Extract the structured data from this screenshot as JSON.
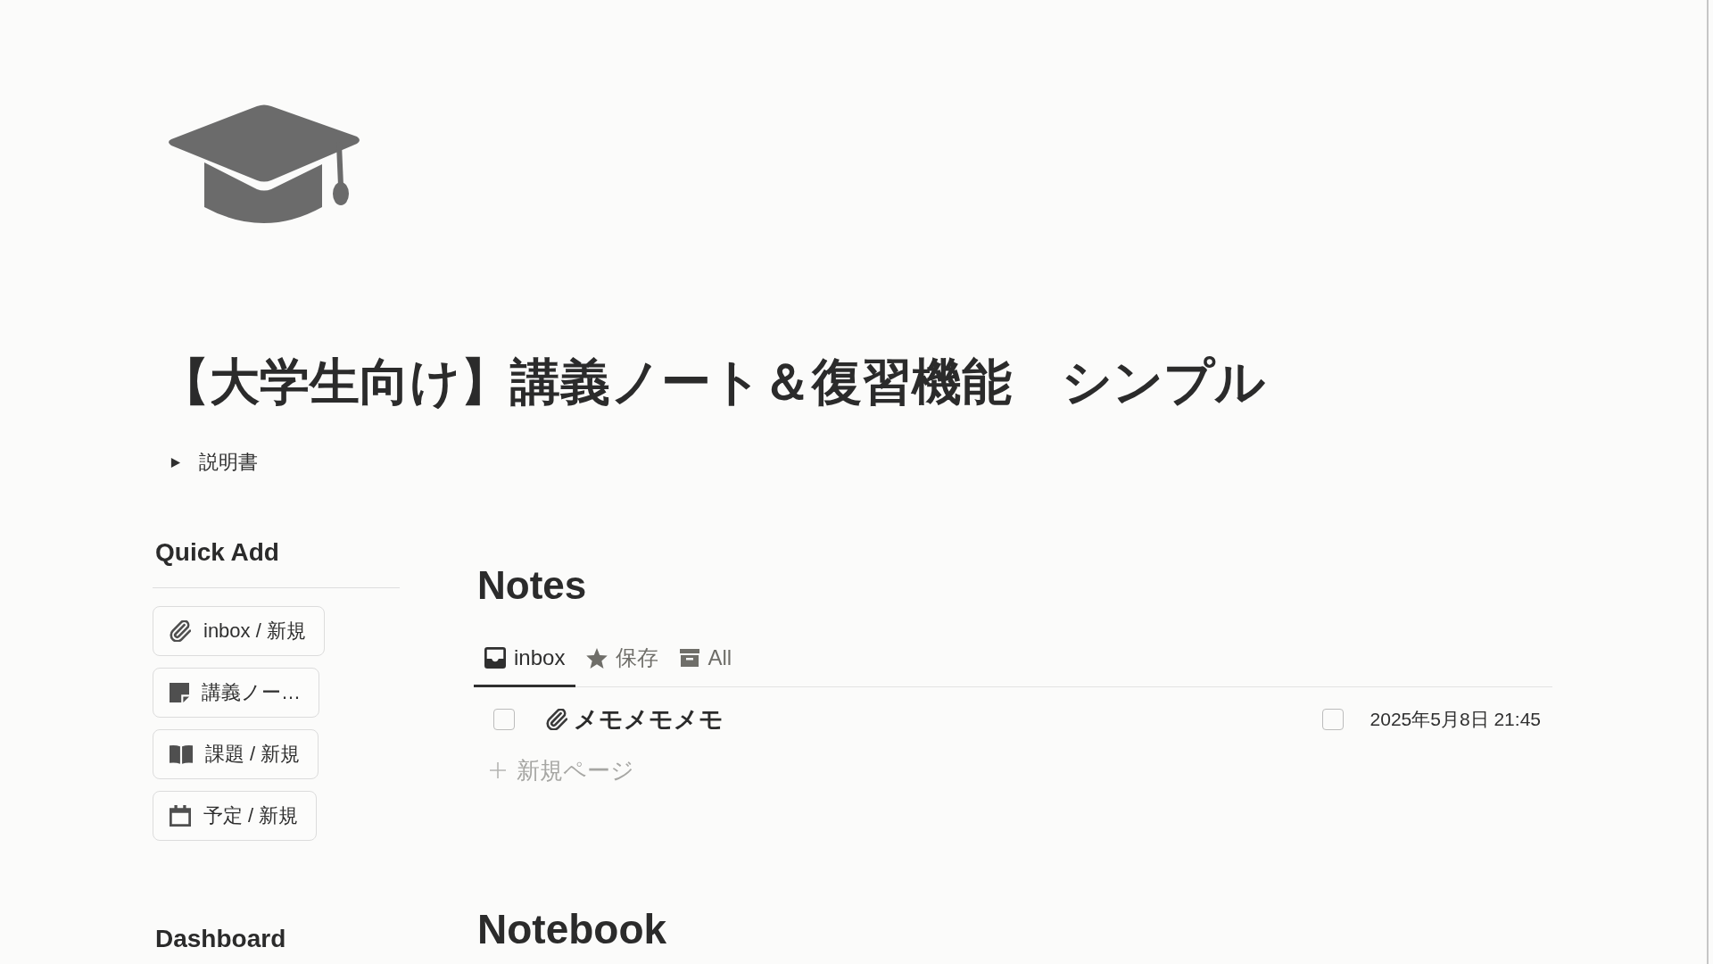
{
  "page": {
    "title": "【大学生向け】講義ノート＆復習機能　シンプル",
    "toggle": {
      "label": "説明書",
      "expanded": false
    }
  },
  "quick_add": {
    "heading": "Quick Add",
    "buttons": [
      {
        "kind": "memo",
        "label": "inbox / 新規"
      },
      {
        "kind": "lecture",
        "label": "講義ノー…"
      },
      {
        "kind": "assignment",
        "label": "課題 / 新規"
      },
      {
        "kind": "schedule",
        "label": "予定 / 新規"
      }
    ]
  },
  "dashboard": {
    "heading": "Dashboard"
  },
  "notes": {
    "heading": "Notes",
    "tabs": [
      {
        "kind": "inbox",
        "label": "inbox",
        "selected": true
      },
      {
        "kind": "saved",
        "label": "保存",
        "selected": false
      },
      {
        "kind": "all",
        "label": "All",
        "selected": false
      }
    ],
    "rows": [
      {
        "kind": "memo",
        "title": "メモメモメモ",
        "checked": false,
        "column_3_checked": false,
        "column_4": "2025年5月8日 21:45"
      }
    ],
    "new_page": {
      "label": "新規ページ"
    }
  },
  "notebook": {
    "heading": "Notebook"
  }
}
